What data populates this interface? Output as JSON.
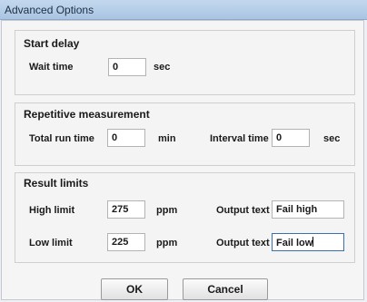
{
  "window": {
    "title": "Advanced Options"
  },
  "start_delay": {
    "title": "Start delay",
    "wait_time_label": "Wait time",
    "wait_time_value": "0",
    "wait_time_unit": "sec"
  },
  "repetitive": {
    "title": "Repetitive measurement",
    "total_run_label": "Total run time",
    "total_run_value": "0",
    "total_run_unit": "min",
    "interval_label": "Interval time",
    "interval_value": "0",
    "interval_unit": "sec"
  },
  "result_limits": {
    "title": "Result limits",
    "high_label": "High limit",
    "high_value": "275",
    "high_unit": "ppm",
    "high_output_label": "Output text",
    "high_output_value": "Fail high",
    "low_label": "Low limit",
    "low_value": "225",
    "low_unit": "ppm",
    "low_output_label": "Output text",
    "low_output_value": "Fail low"
  },
  "buttons": {
    "ok": "OK",
    "cancel": "Cancel"
  }
}
